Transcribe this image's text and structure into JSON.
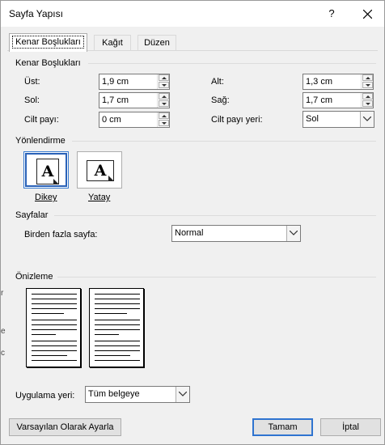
{
  "window": {
    "title": "Sayfa Yapısı",
    "help_label": "?"
  },
  "tabs": [
    {
      "label": "Kenar Boşlukları",
      "active": true
    },
    {
      "label": "Kağıt",
      "active": false
    },
    {
      "label": "Düzen",
      "active": false
    }
  ],
  "margins": {
    "title": "Kenar Boşlukları",
    "top": {
      "label": "Üst:",
      "value": "1,9 cm"
    },
    "bottom": {
      "label": "Alt:",
      "value": "1,3 cm"
    },
    "left": {
      "label": "Sol:",
      "value": "1,7 cm"
    },
    "right": {
      "label": "Sağ:",
      "value": "1,7 cm"
    },
    "gutter": {
      "label": "Cilt payı:",
      "value": "0 cm"
    },
    "gutter_position": {
      "label": "Cilt payı yeri:",
      "value": "Sol"
    }
  },
  "orientation": {
    "title": "Yönlendirme",
    "portrait": {
      "label": "Dikey",
      "glyph": "A",
      "selected": true
    },
    "landscape": {
      "label": "Yatay",
      "glyph": "A",
      "selected": false
    }
  },
  "pages": {
    "title": "Sayfalar",
    "multiple_label": "Birden fazla sayfa:",
    "multiple_value": "Normal"
  },
  "preview": {
    "title": "Önizleme"
  },
  "apply": {
    "label": "Uygulama yeri:",
    "value": "Tüm belgeye"
  },
  "buttons": {
    "set_default": "Varsayılan Olarak Ayarla",
    "ok": "Tamam",
    "cancel": "İptal"
  },
  "background_edge": [
    "r",
    "e",
    "c"
  ],
  "colors": {
    "dialog_bg": "#f0f0f0",
    "accent": "#2f74d0",
    "border": "#adadad"
  },
  "icons": [
    "close-icon",
    "spin-up-icon",
    "spin-down-icon",
    "dropdown-arrow-icon",
    "portrait-page-icon",
    "landscape-page-icon"
  ]
}
